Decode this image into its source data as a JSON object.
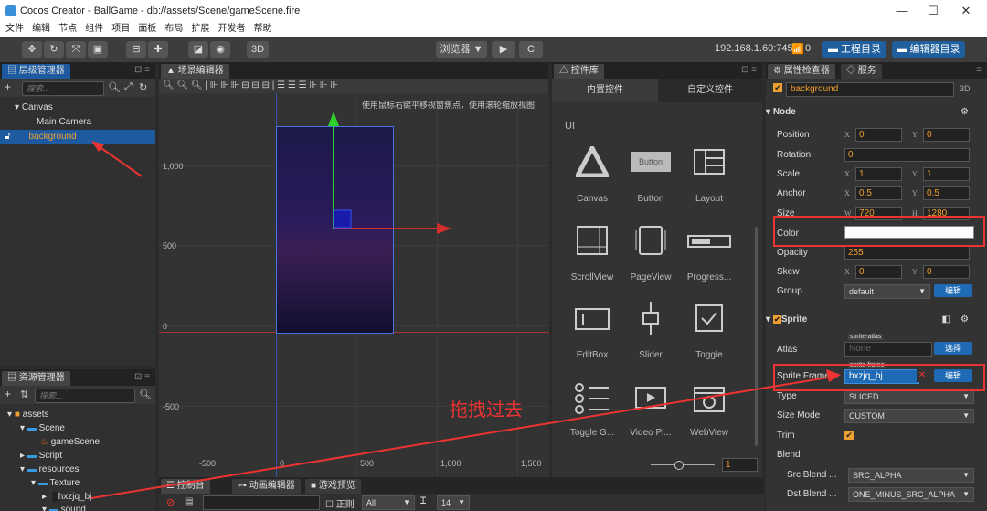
{
  "window": {
    "title": "Cocos Creator - BallGame - db://assets/Scene/gameScene.fire",
    "min": "—",
    "max": "☐",
    "close": "✕"
  },
  "menu": [
    "文件",
    "编辑",
    "节点",
    "组件",
    "项目",
    "面板",
    "布局",
    "扩展",
    "开发者",
    "帮助"
  ],
  "toolbar": {
    "three_d": "3D",
    "browser": "浏览器 ▼",
    "play": "▶",
    "refresh": "C",
    "ip": "192.168.1.60:7456",
    "wifi_count": "0",
    "project_dir": "工程目录",
    "editor_dir": "编辑器目录"
  },
  "hierarchy": {
    "tab": "层级管理器",
    "search_placeholder": "搜索...",
    "items": [
      {
        "label": "Canvas"
      },
      {
        "label": "Main Camera"
      },
      {
        "label": "background"
      }
    ]
  },
  "assets": {
    "tab": "资源管理器",
    "search_placeholder": "搜索...",
    "items": [
      {
        "label": "assets"
      },
      {
        "label": "Scene"
      },
      {
        "label": "gameScene"
      },
      {
        "label": "Script"
      },
      {
        "label": "resources"
      },
      {
        "label": "Texture"
      },
      {
        "label": "hxzjq_bj"
      },
      {
        "label": "sound"
      }
    ]
  },
  "scene": {
    "tab": "场景编辑器",
    "hint": "使用鼠标右键平移视窗焦点，使用滚轮缩放视图",
    "y_ticks": [
      "1,000",
      "500",
      "0",
      "-500"
    ],
    "x_ticks": [
      "-500",
      "0",
      "500",
      "1,000",
      "1,500"
    ],
    "annotation": "拖拽过去"
  },
  "console": {
    "tabs": [
      "控制台",
      "动画编辑器",
      "游戏预览"
    ],
    "regex": "正则",
    "level": "All",
    "font_size": "14"
  },
  "widgets": {
    "tab": "控件库",
    "subtabs": [
      "内置控件",
      "自定义控件"
    ],
    "group": "UI",
    "items": [
      {
        "label": "Canvas"
      },
      {
        "label": "Button"
      },
      {
        "label": "Layout"
      },
      {
        "label": "ScrollView"
      },
      {
        "label": "PageView"
      },
      {
        "label": "Progress..."
      },
      {
        "label": "EditBox"
      },
      {
        "label": "Slider"
      },
      {
        "label": "Toggle"
      },
      {
        "label": "Toggle G..."
      },
      {
        "label": "Video Pl..."
      },
      {
        "label": "WebView"
      }
    ],
    "button_text": "Button",
    "zoom_value": "1"
  },
  "inspector": {
    "tabs": [
      "属性检查器",
      "服务"
    ],
    "node_name": "background",
    "three_d": "3D",
    "node_section": "Node",
    "position": {
      "label": "Position",
      "x": "0",
      "y": "0"
    },
    "rotation": {
      "label": "Rotation",
      "value": "0"
    },
    "scale": {
      "label": "Scale",
      "x": "1",
      "y": "1"
    },
    "anchor": {
      "label": "Anchor",
      "x": "0.5",
      "y": "0.5"
    },
    "size": {
      "label": "Size",
      "w": "720",
      "h": "1280"
    },
    "color": {
      "label": "Color",
      "value": "#ffffff"
    },
    "opacity": {
      "label": "Opacity",
      "value": "255"
    },
    "skew": {
      "label": "Skew",
      "x": "0",
      "y": "0"
    },
    "group": {
      "label": "Group",
      "value": "default",
      "edit": "编辑"
    },
    "sprite_section": "Sprite",
    "atlas": {
      "label": "Atlas",
      "tag": "sprite-atlas",
      "value": "None",
      "btn": "选择"
    },
    "sprite_frame": {
      "label": "Sprite Frame",
      "tag": "sprite-frame",
      "value": "hxzjq_bj",
      "btn": "编辑"
    },
    "type": {
      "label": "Type",
      "value": "SLICED"
    },
    "size_mode": {
      "label": "Size Mode",
      "value": "CUSTOM"
    },
    "trim": {
      "label": "Trim"
    },
    "blend": {
      "label": "Blend"
    },
    "src_blend": {
      "label": "Src Blend ...",
      "value": "SRC_ALPHA"
    },
    "dst_blend": {
      "label": "Dst Blend ...",
      "value": "ONE_MINUS_SRC_ALPHA"
    },
    "axis": {
      "x": "X",
      "y": "Y",
      "w": "W",
      "h": "H"
    }
  }
}
